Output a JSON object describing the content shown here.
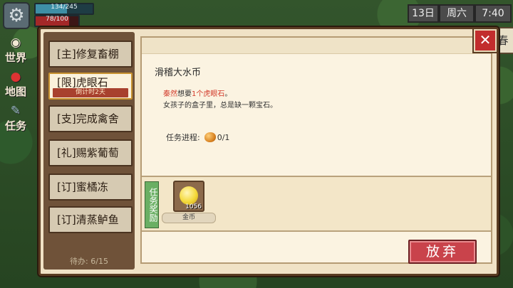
{
  "hud": {
    "energy_text": "134/245",
    "energy_value": 134,
    "energy_max": 245,
    "health_text": "78/100",
    "health_value": 78,
    "health_max": 100,
    "settings_icon": "gear-icon"
  },
  "side_menu": [
    {
      "label": "世界",
      "icon": "world-icon"
    },
    {
      "label": "地图",
      "icon": "map-pin-icon"
    },
    {
      "label": "任务",
      "icon": "quest-icon"
    }
  ],
  "top_right": {
    "day": "13日",
    "weekday": "周六",
    "time": "7:40",
    "season": "春"
  },
  "quest_list": {
    "items": [
      {
        "label": "[主]修复畜棚"
      },
      {
        "label": "[限]虎眼石",
        "timer": "倒计时2天",
        "selected": true
      },
      {
        "label": "[支]完成禽舍"
      },
      {
        "label": "[礼]赐紫葡萄"
      },
      {
        "label": "[订]蜜橘冻"
      },
      {
        "label": "[订]清蒸鲈鱼"
      }
    ],
    "pending": "待办:  6/15"
  },
  "detail": {
    "title": "滑稽大水币",
    "desc_name": "秦然",
    "desc_mid": "想要",
    "desc_item": "1个虎眼石",
    "desc_end": "。",
    "desc_line2": "女孩子的盒子里，总是缺一颗宝石。",
    "progress_label": "任务进程:",
    "progress_value": "0/1",
    "progress_icon": "tiger-eye-stone-icon",
    "reward_tag": "任务奖励",
    "reward_qty": "1056",
    "reward_name": "金币",
    "reward_icon": "gold-coin-icon",
    "giveup_label": "放弃"
  },
  "colors": {
    "accent_red": "#c9434b",
    "panel_bg": "#fbf3e1",
    "wood": "#6f5239",
    "highlight": "#d23a2a"
  }
}
